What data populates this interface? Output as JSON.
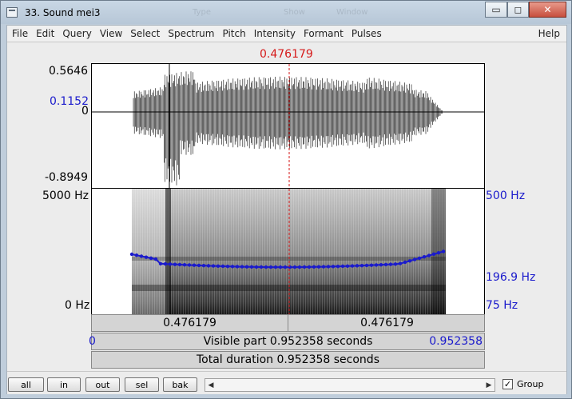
{
  "window": {
    "title": "33. Sound mei3",
    "ghost_text": [
      "Type",
      "Show",
      "Window"
    ],
    "controls": {
      "minimize": "▭",
      "maximize": "◻",
      "close": "✕"
    }
  },
  "menu": {
    "items": [
      "File",
      "Edit",
      "Query",
      "View",
      "Select",
      "Spectrum",
      "Pitch",
      "Intensity",
      "Formant",
      "Pulses"
    ],
    "help": "Help"
  },
  "cursor": {
    "time_label": "0.476179",
    "fraction": 0.5
  },
  "waveform": {
    "max_label": "0.5646",
    "marker_label": "0.1152",
    "zero_label": "0",
    "min_label": "-0.8949"
  },
  "spectrogram": {
    "freq_top_label": "5000 Hz",
    "freq_bottom_label": "0 Hz",
    "pitch_top_label": "500 Hz",
    "pitch_value_label": "196.9 Hz",
    "pitch_bottom_label": "75 Hz"
  },
  "selection_bar": {
    "left_time": "0.476179",
    "right_time": "0.476179"
  },
  "visible_bar": {
    "start": "0",
    "text": "Visible part 0.952358 seconds",
    "end": "0.952358"
  },
  "total_bar": {
    "text": "Total duration 0.952358 seconds"
  },
  "bottom": {
    "buttons": [
      "all",
      "in",
      "out",
      "sel",
      "bak"
    ],
    "scroll_left": "◀",
    "scroll_right": "▶",
    "group_checked": "✓",
    "group_label": "Group"
  },
  "colors": {
    "cursor": "#d61a1a",
    "pitch": "#1a1acc",
    "wave": "#000000"
  }
}
